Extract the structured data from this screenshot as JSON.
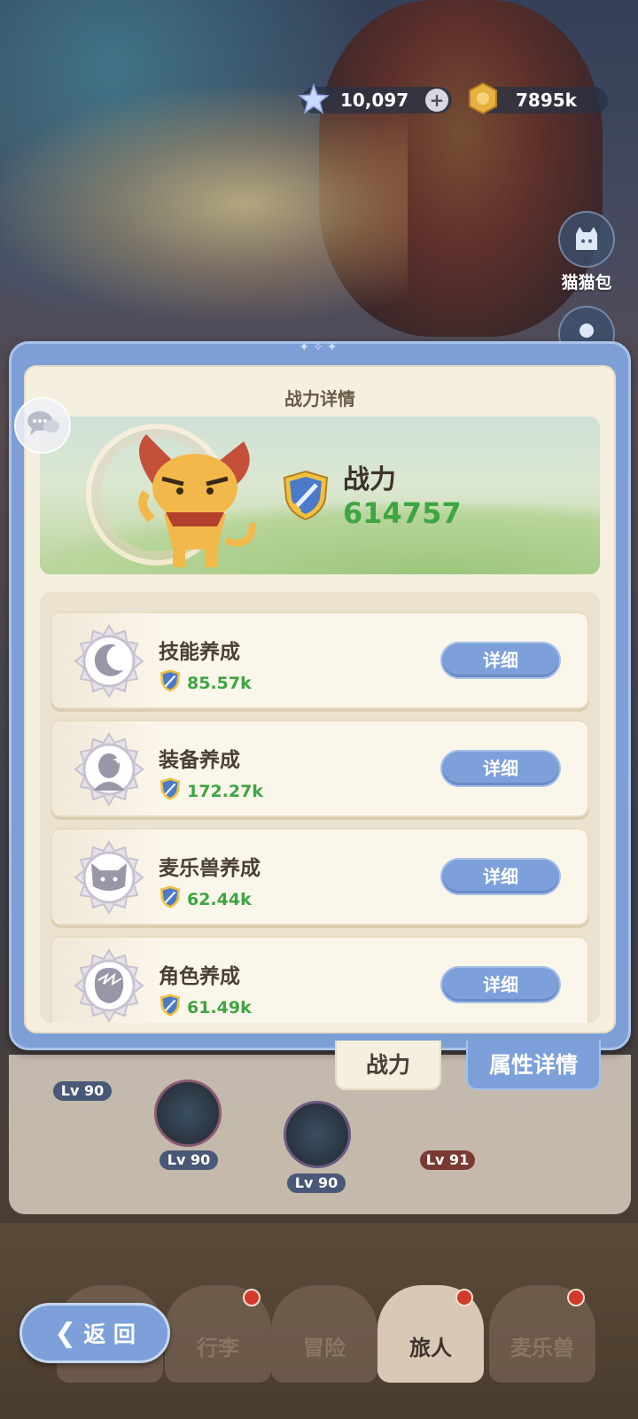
{
  "currency": {
    "gems": "10,097",
    "gold": "7895k"
  },
  "side": {
    "cat_bag": "猫猫包"
  },
  "panel": {
    "title": "战力详情",
    "power_label": "战力",
    "power_value": "614757",
    "rows": [
      {
        "name": "技能养成",
        "value": "85.57k",
        "button": "详细",
        "icon": "moon-star-icon"
      },
      {
        "name": "装备养成",
        "value": "172.27k",
        "button": "详细",
        "icon": "alien-head-icon"
      },
      {
        "name": "麦乐兽养成",
        "value": "62.44k",
        "button": "详细",
        "icon": "cat-face-icon"
      },
      {
        "name": "角色养成",
        "value": "61.49k",
        "button": "详细",
        "icon": "character-head-icon"
      }
    ]
  },
  "tabs": {
    "power": "战力",
    "attributes": "属性详情"
  },
  "tree": {
    "levels": [
      "Lv 90",
      "Lv 90",
      "Lv 90",
      "Lv 91"
    ]
  },
  "nav": {
    "back": "返 回",
    "items": [
      "行李",
      "冒险",
      "旅人",
      "麦乐兽"
    ]
  },
  "colors": {
    "accent_blue": "#7ea0da",
    "power_green": "#3fa543",
    "panel_bg": "#f5efe0"
  }
}
